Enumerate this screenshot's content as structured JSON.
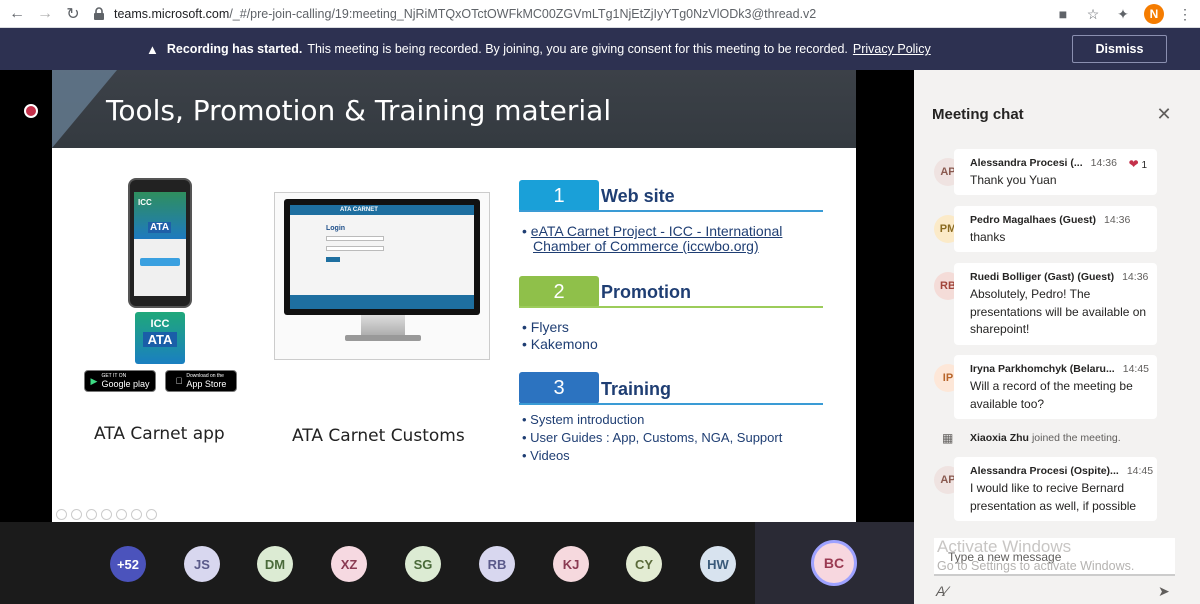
{
  "browser": {
    "url_host": "teams.microsoft.com",
    "url_path": "/_#/pre-join-calling/19:meeting_NjRiMTQxOTctOWFkMC00ZGVmLTg1NjEtZjIyYTg0NzVlODk3@thread.v2",
    "profile_initial": "N"
  },
  "banner": {
    "bold_text": "Recording has started.",
    "text": "This meeting is being recorded. By joining, you are giving consent for this meeting to be recorded.",
    "link": "Privacy Policy",
    "dismiss_label": "Dismiss"
  },
  "slide": {
    "title": "Tools, Promotion & Training material",
    "phone_icc": "ICC",
    "phone_ata": "ATA",
    "app_icc": "ICC",
    "app_ata": "ATA",
    "google_small": "GET IT ON",
    "google_label": "Google play",
    "apple_small": "Download on the",
    "apple_label": "App Store",
    "caption_app": "ATA Carnet app",
    "caption_customs": "ATA Carnet Customs",
    "monitor_brand": "ATA CARNET",
    "monitor_login": "Login",
    "sections": [
      {
        "num": "1",
        "title": "Web site",
        "color": "#1aa0d8",
        "line": "#3a9bd5"
      },
      {
        "num": "2",
        "title": "Promotion",
        "color": "#8fc04a",
        "line": "#9ccc5a"
      },
      {
        "num": "3",
        "title": "Training",
        "color": "#2c73c0",
        "line": "#3a9bd5"
      }
    ],
    "web_link_1": "eATA Carnet Project - ICC - International",
    "web_link_2": "Chamber of Commerce (iccwbo.org)",
    "promo_items": [
      "Flyers",
      "Kakemono"
    ],
    "training_items": [
      "System introduction",
      "User Guides : App, Customs, NGA, Support",
      "Videos"
    ]
  },
  "participants": [
    {
      "initials": "+52",
      "color": "#4b53bc"
    },
    {
      "initials": "JS",
      "color": "#d8d7ef"
    },
    {
      "initials": "DM",
      "color": "#dcebd3"
    },
    {
      "initials": "XZ",
      "color": "#f6d9e1"
    },
    {
      "initials": "SG",
      "color": "#dcebd3"
    },
    {
      "initials": "RB",
      "color": "#d8d7ef"
    },
    {
      "initials": "KJ",
      "color": "#f6d9de"
    },
    {
      "initials": "CY",
      "color": "#e3ecd3"
    },
    {
      "initials": "HW",
      "color": "#d8e3ef"
    }
  ],
  "self_initials": "BC",
  "chat": {
    "title": "Meeting chat",
    "messages": [
      {
        "initials": "AP",
        "name": "Alessandra Procesi (...",
        "time": "14:36",
        "text": "Thank you Yuan",
        "reaction": "1",
        "avatar_color": "#efe3e1",
        "avatar_text": "#8a5a50"
      },
      {
        "initials": "PM",
        "name": "Pedro Magalhaes (Guest)",
        "time": "14:36",
        "text": "thanks",
        "avatar_color": "#fbeac8",
        "avatar_text": "#8a6a20"
      },
      {
        "initials": "RB",
        "name": "Ruedi Bolliger (Gast) (Guest)",
        "time": "14:36",
        "text": "Absolutely, Pedro! The presentations will be available on sharepoint!",
        "avatar_color": "#f4dcd8",
        "avatar_text": "#a0453a"
      },
      {
        "initials": "IP",
        "name": "Iryna Parkhomchyk (Belaru...",
        "time": "14:45",
        "text": "Will a record of the meeting be available too?",
        "avatar_color": "#fde7d8",
        "avatar_text": "#b8652a"
      },
      {
        "initials": "AP",
        "name": "Alessandra Procesi (Ospite)...",
        "time": "14:45",
        "text": "I would like to recive Bernard presentation as well, if possible",
        "avatar_color": "#efe3e1",
        "avatar_text": "#8a5a50"
      }
    ],
    "system_name": "Xiaoxia Zhu",
    "system_text": "joined the meeting.",
    "compose_placeholder": "Type a new message",
    "watermark_1": "Activate Windows",
    "watermark_2": "Go to Settings to activate Windows."
  }
}
